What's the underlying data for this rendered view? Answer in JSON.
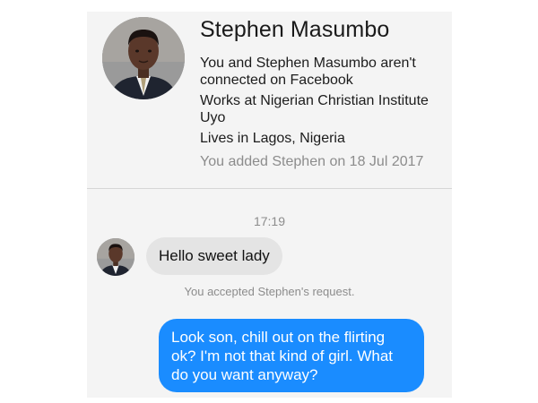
{
  "profile": {
    "name": "Stephen Masumbo",
    "connection_status": "You and Stephen Masumbo aren't connected on Facebook",
    "work": "Works at Nigerian Christian Institute Uyo",
    "location": "Lives in Lagos, Nigeria",
    "added": "You added Stephen on 18 Jul 2017"
  },
  "thread": {
    "timestamp": "17:19",
    "incoming_message": "Hello sweet lady",
    "system_notice": "You accepted Stephen's request.",
    "outgoing_message": "Look son, chill out on the flirting ok? I'm not that kind of girl. What do you want anyway?"
  },
  "colors": {
    "outgoing_bubble": "#1a8cff",
    "incoming_bubble": "#e4e4e4",
    "muted_text": "#8c8c8c",
    "card_background": "#f4f4f4"
  },
  "icons": {
    "profile_avatar": "avatar-photo",
    "sender_avatar": "avatar-photo"
  }
}
